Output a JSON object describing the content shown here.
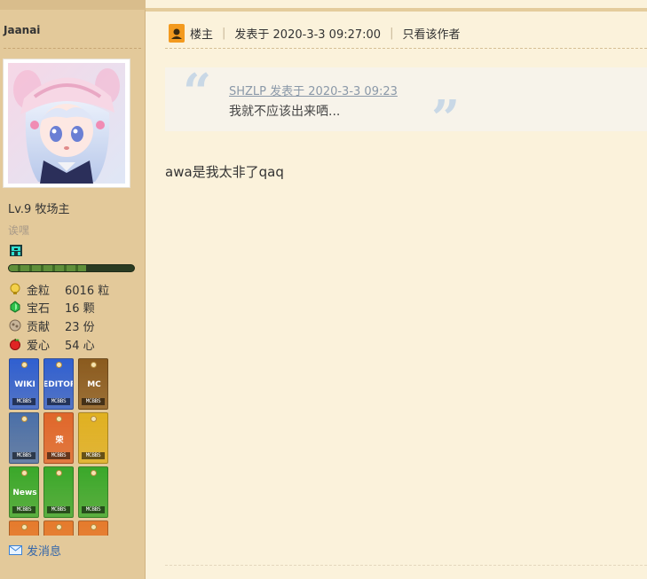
{
  "user": {
    "name": "Jaanai",
    "level": "Lv.9 牧场主",
    "custom_title": "诶嘿",
    "exp_percent": 62
  },
  "stats": [
    {
      "label": "金粒",
      "value": "6016 粒",
      "icon": "gold-nugget-icon"
    },
    {
      "label": "宝石",
      "value": "16 颗",
      "icon": "emerald-icon"
    },
    {
      "label": "贡献",
      "value": "23 份",
      "icon": "contribution-icon"
    },
    {
      "label": "爱心",
      "value": "54 心",
      "icon": "apple-heart-icon"
    }
  ],
  "medals": [
    {
      "name": "wiki-medal",
      "text": "WIKI",
      "mark": "MCBBS",
      "color": "#2f5fd0"
    },
    {
      "name": "editor-medal",
      "text": "EDITOR",
      "mark": "MCBBS",
      "color": "#2f5fd0"
    },
    {
      "name": "mc-paper-medal",
      "text": "MC",
      "mark": "MCBBS",
      "color": "#8a5a1e"
    },
    {
      "name": "bread-medal",
      "text": "",
      "mark": "MCBBS",
      "color": "#4a6fa8"
    },
    {
      "name": "rong-medal",
      "text": "荣",
      "mark": "MCBBS",
      "color": "#e0662a"
    },
    {
      "name": "miner-medal",
      "text": "",
      "mark": "MCBBS",
      "color": "#e0b020"
    },
    {
      "name": "news-medal",
      "text": "News",
      "mark": "MCBBS",
      "color": "#3aa82a"
    },
    {
      "name": "book-medal",
      "text": "",
      "mark": "MCBBS",
      "color": "#3aa82a"
    },
    {
      "name": "no-bug-medal",
      "text": "",
      "mark": "MCBBS",
      "color": "#3aa82a"
    },
    {
      "name": "orange-medal-1",
      "text": "",
      "mark": "",
      "color": "#e57a2c"
    },
    {
      "name": "orange-medal-2",
      "text": "",
      "mark": "",
      "color": "#e57a2c"
    },
    {
      "name": "orange-medal-3",
      "text": "",
      "mark": "",
      "color": "#e57a2c"
    }
  ],
  "send_message": "发消息",
  "post": {
    "floor_label": "楼主",
    "posted_at": "发表于 2020-3-3 09:27:00",
    "only_author": "只看该作者",
    "quote_author": "SHZLP 发表于 2020-3-3 09:23",
    "quote_text": "我就不应该出来哂...",
    "body": "awa是我太非了qaq"
  },
  "colors": {
    "sidebar_bg": "#e3c99a",
    "page_bg": "#fbf2db",
    "quote_bg": "#f7f3ea",
    "link": "#3366aa"
  }
}
